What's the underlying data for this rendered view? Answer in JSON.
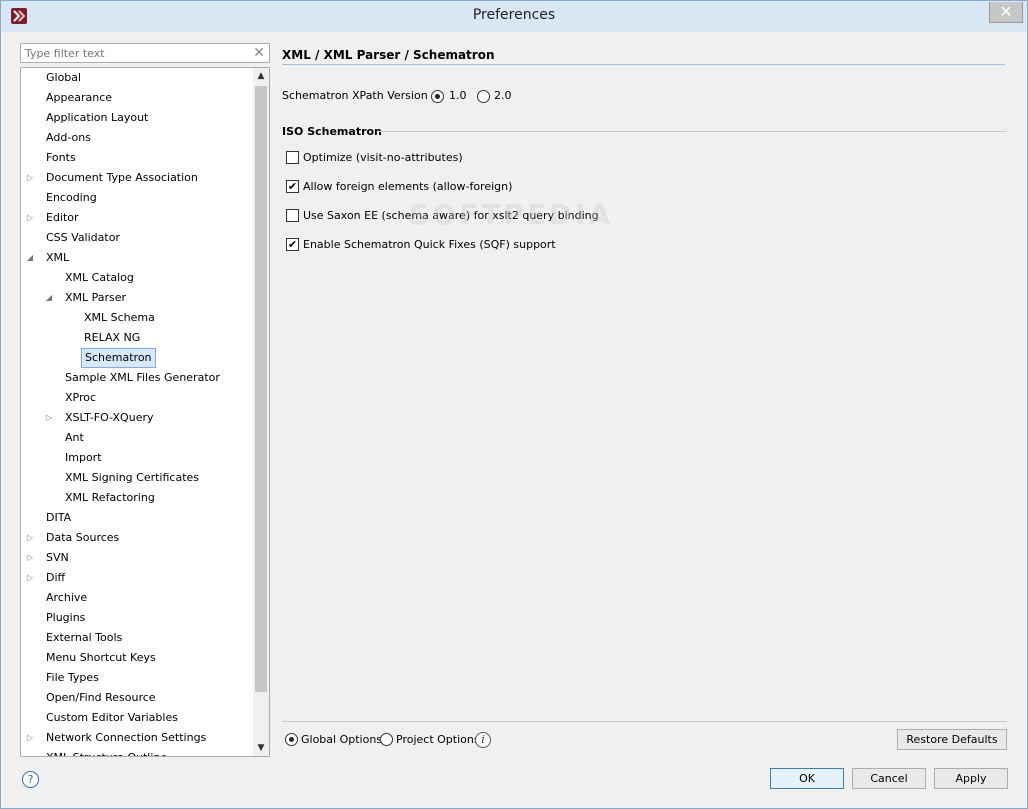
{
  "window": {
    "title": "Preferences",
    "close_glyph": "✕"
  },
  "filter": {
    "placeholder": "Type filter text",
    "clear_glyph": "✕"
  },
  "tree": {
    "items": [
      {
        "label": "Global",
        "arrow": ""
      },
      {
        "label": "Appearance",
        "arrow": ""
      },
      {
        "label": "Application Layout",
        "arrow": ""
      },
      {
        "label": "Add-ons",
        "arrow": ""
      },
      {
        "label": "Fonts",
        "arrow": ""
      },
      {
        "label": "Document Type Association",
        "arrow": "▷"
      },
      {
        "label": "Encoding",
        "arrow": ""
      },
      {
        "label": "Editor",
        "arrow": "▷"
      },
      {
        "label": "CSS Validator",
        "arrow": ""
      },
      {
        "label": "XML",
        "arrow": "◢"
      },
      {
        "label": "XML Catalog",
        "arrow": ""
      },
      {
        "label": "XML Parser",
        "arrow": "◢"
      },
      {
        "label": "XML Schema",
        "arrow": ""
      },
      {
        "label": "RELAX NG",
        "arrow": ""
      },
      {
        "label": "Schematron",
        "arrow": ""
      },
      {
        "label": "Sample XML Files Generator",
        "arrow": ""
      },
      {
        "label": "XProc",
        "arrow": ""
      },
      {
        "label": "XSLT-FO-XQuery",
        "arrow": "▷"
      },
      {
        "label": "Ant",
        "arrow": ""
      },
      {
        "label": "Import",
        "arrow": ""
      },
      {
        "label": "XML Signing Certificates",
        "arrow": ""
      },
      {
        "label": "XML Refactoring",
        "arrow": ""
      },
      {
        "label": "DITA",
        "arrow": ""
      },
      {
        "label": "Data Sources",
        "arrow": "▷"
      },
      {
        "label": "SVN",
        "arrow": "▷"
      },
      {
        "label": "Diff",
        "arrow": "▷"
      },
      {
        "label": "Archive",
        "arrow": ""
      },
      {
        "label": "Plugins",
        "arrow": ""
      },
      {
        "label": "External Tools",
        "arrow": ""
      },
      {
        "label": "Menu Shortcut Keys",
        "arrow": ""
      },
      {
        "label": "File Types",
        "arrow": ""
      },
      {
        "label": "Open/Find Resource",
        "arrow": ""
      },
      {
        "label": "Custom Editor Variables",
        "arrow": ""
      },
      {
        "label": "Network Connection Settings",
        "arrow": "▷"
      },
      {
        "label": "XML Structure Outline",
        "arrow": ""
      }
    ],
    "selected_label": "Schematron",
    "scroll_up": "▲",
    "scroll_down": "▼"
  },
  "panel": {
    "title": "XML / XML Parser / Schematron",
    "xpath_version": {
      "label": "Schematron XPath Version",
      "option1": "1.0",
      "option2": "2.0",
      "selected": "1.0"
    },
    "iso_section": {
      "title": "ISO Schematron",
      "options": [
        {
          "label": "Optimize (visit-no-attributes)",
          "checked": false
        },
        {
          "label": "Allow foreign elements (allow-foreign)",
          "checked": true
        },
        {
          "label": "Use Saxon EE (schema aware) for xslt2 query binding",
          "checked": false
        },
        {
          "label": "Enable Schematron Quick Fixes (SQF) support",
          "checked": true
        }
      ]
    },
    "watermark": "SOFTPEDIA",
    "scope": {
      "global_label": "Global Options",
      "project_label": "Project Options",
      "selected": "Global Options",
      "info_glyph": "i"
    },
    "restore_defaults_label": "Restore Defaults"
  },
  "footer": {
    "help_glyph": "?",
    "ok_label": "OK",
    "cancel_label": "Cancel",
    "apply_label": "Apply"
  },
  "colors": {
    "accent": "#3c7fb1",
    "selection_bg": "#d7e8f9",
    "title_bar": "#d9e7f5"
  }
}
